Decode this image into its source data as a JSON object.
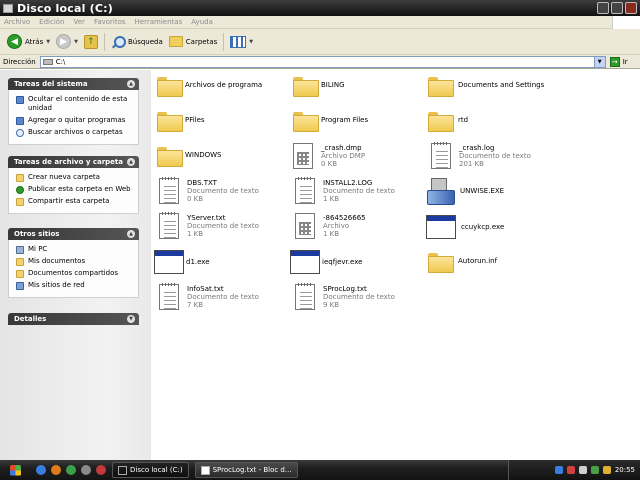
{
  "window": {
    "title": "Disco local (C:)",
    "menu": [
      "Archivo",
      "Edición",
      "Ver",
      "Favoritos",
      "Herramientas",
      "Ayuda"
    ]
  },
  "toolbar": {
    "back_label": "Atrás",
    "search_label": "Búsqueda",
    "folders_label": "Carpetas"
  },
  "address": {
    "label": "Dirección",
    "value": "C:\\",
    "go_label": "Ir"
  },
  "sidebar": {
    "system_tasks": {
      "title": "Tareas del sistema",
      "items": [
        {
          "label": "Ocultar el contenido de esta unidad",
          "icon": "hide-contents-icon"
        },
        {
          "label": "Agregar o quitar programas",
          "icon": "add-remove-programs-icon"
        },
        {
          "label": "Buscar archivos o carpetas",
          "icon": "search-files-icon"
        }
      ]
    },
    "file_tasks": {
      "title": "Tareas de archivo y carpeta",
      "items": [
        {
          "label": "Crear nueva carpeta",
          "icon": "new-folder-icon"
        },
        {
          "label": "Publicar esta carpeta en Web",
          "icon": "publish-web-icon"
        },
        {
          "label": "Compartir esta carpeta",
          "icon": "share-folder-icon"
        }
      ]
    },
    "other_places": {
      "title": "Otros sitios",
      "items": [
        {
          "label": "Mi PC",
          "icon": "my-computer-icon"
        },
        {
          "label": "Mis documentos",
          "icon": "my-documents-icon"
        },
        {
          "label": "Documentos compartidos",
          "icon": "shared-documents-icon"
        },
        {
          "label": "Mis sitios de red",
          "icon": "network-places-icon"
        }
      ]
    },
    "details": {
      "title": "Detalles"
    }
  },
  "files": [
    {
      "name": "Archivos de programa",
      "type": "",
      "size": "",
      "icon": "folder-icon"
    },
    {
      "name": "BILING",
      "type": "",
      "size": "",
      "icon": "folder-icon"
    },
    {
      "name": "Documents and Settings",
      "type": "",
      "size": "",
      "icon": "folder-icon"
    },
    {
      "name": "PFiles",
      "type": "",
      "size": "",
      "icon": "folder-icon"
    },
    {
      "name": "Program Files",
      "type": "",
      "size": "",
      "icon": "folder-icon"
    },
    {
      "name": "rtd",
      "type": "",
      "size": "",
      "icon": "folder-icon"
    },
    {
      "name": "WINDOWS",
      "type": "",
      "size": "",
      "icon": "folder-icon"
    },
    {
      "name": "_crash.dmp",
      "type": "Archivo DMP",
      "size": "0 KB",
      "icon": "binary-file-icon"
    },
    {
      "name": "_crash.log",
      "type": "Documento de texto",
      "size": "201 KB",
      "icon": "text-file-icon"
    },
    {
      "name": "DBS.TXT",
      "type": "Documento de texto",
      "size": "0 KB",
      "icon": "text-file-icon"
    },
    {
      "name": "INSTALL2.LOG",
      "type": "Documento de texto",
      "size": "1 KB",
      "icon": "text-file-icon"
    },
    {
      "name": "UNWISE.EXE",
      "type": "",
      "size": "",
      "icon": "setup-program-icon"
    },
    {
      "name": "YServer.txt",
      "type": "Documento de texto",
      "size": "1 KB",
      "icon": "text-file-icon"
    },
    {
      "name": "-864526665",
      "type": "Archivo",
      "size": "1 KB",
      "icon": "binary-file-icon"
    },
    {
      "name": "ccuykcp.exe",
      "type": "",
      "size": "",
      "icon": "program-window-icon"
    },
    {
      "name": "d1.exe",
      "type": "",
      "size": "",
      "icon": "program-window-icon"
    },
    {
      "name": "ieqfjevr.exe",
      "type": "",
      "size": "",
      "icon": "program-window-icon"
    },
    {
      "name": "Autorun.inf",
      "type": "",
      "size": "",
      "icon": "folder-icon"
    },
    {
      "name": "InfoSat.txt",
      "type": "Documento de texto",
      "size": "7 KB",
      "icon": "text-file-icon"
    },
    {
      "name": "SProcLog.txt",
      "type": "Documento de texto",
      "size": "9 KB",
      "icon": "text-file-icon"
    }
  ],
  "taskbar": {
    "buttons": [
      {
        "label": "Disco local (C:)",
        "active": true
      },
      {
        "label": "SProcLog.txt - Bloc d...",
        "active": false
      }
    ],
    "clock": "20:55"
  }
}
